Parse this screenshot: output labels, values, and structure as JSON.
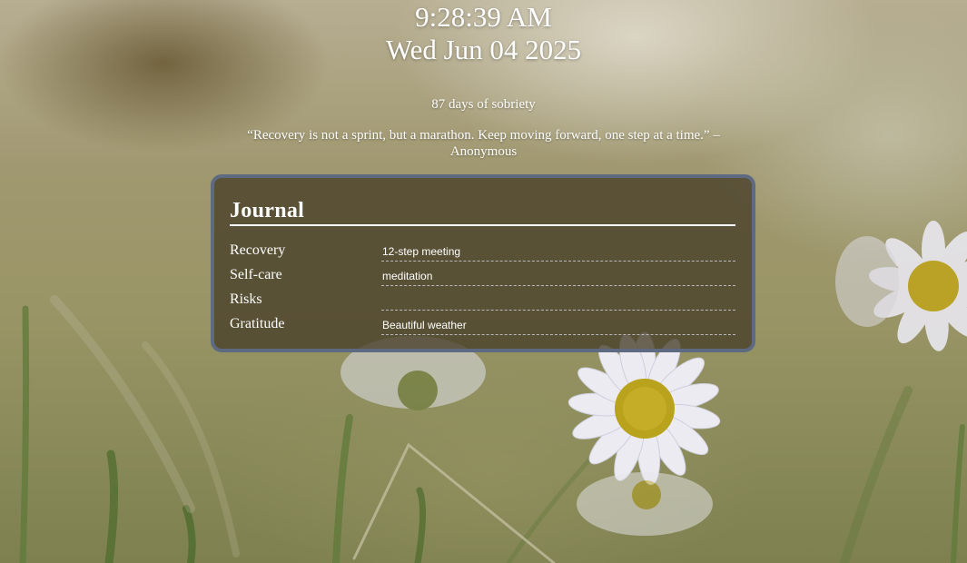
{
  "clock": {
    "time": "9:28:39 AM",
    "date": "Wed Jun 04 2025"
  },
  "sobriety": {
    "text": "87 days of sobriety"
  },
  "quote": {
    "text": "“Recovery is not a sprint, but a marathon. Keep moving forward, one step at a time.” – Anonymous"
  },
  "journal": {
    "title": "Journal",
    "rows": [
      {
        "label": "Recovery",
        "value": "12-step meeting"
      },
      {
        "label": "Self-care",
        "value": "meditation"
      },
      {
        "label": "Risks",
        "value": ""
      },
      {
        "label": "Gratitude",
        "value": "Beautiful weather"
      }
    ]
  },
  "colors": {
    "panel_border": "#5e6a82",
    "panel_background": "rgba(70,62,40,0.78)",
    "text": "#ffffff"
  }
}
